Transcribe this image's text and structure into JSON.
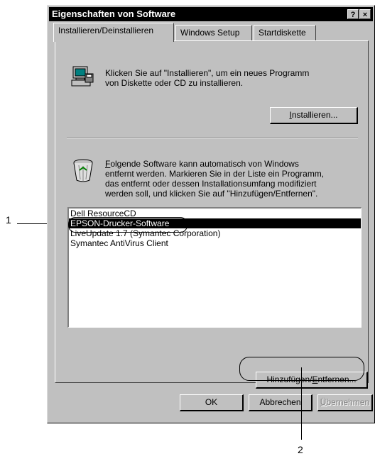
{
  "dialog": {
    "title": "Eigenschaften von Software",
    "help_button": "?",
    "close_button": "×"
  },
  "tabs": [
    {
      "label": "Installieren/Deinstallieren",
      "active": true
    },
    {
      "label": "Windows Setup",
      "active": false
    },
    {
      "label": "Startdiskette",
      "active": false
    }
  ],
  "install_section": {
    "icon": "computer-install-icon",
    "line1": "Klicken Sie auf \"Installieren\", um ein neues Programm",
    "line2": "von Diskette oder CD zu installieren.",
    "button_pre": "",
    "button_u": "I",
    "button_post": "nstallieren..."
  },
  "uninstall_section": {
    "icon": "recycle-bin-icon",
    "line1_u": "F",
    "line1_rest": "olgende Software kann automatisch von Windows",
    "line2": "entfernt werden. Markieren Sie in der Liste ein Programm,",
    "line3": "das entfernt oder dessen Installationsumfang modifiziert",
    "line4": "werden soll, und klicken Sie auf \"Hinzufügen/Entfernen\"."
  },
  "software_list": [
    {
      "label": "Dell ResourceCD",
      "selected": false
    },
    {
      "label": "EPSON-Drucker-Software",
      "selected": true
    },
    {
      "label": "LiveUpdate 1.7 (Symantec Corporation)",
      "selected": false
    },
    {
      "label": "Symantec AntiVirus Client",
      "selected": false
    }
  ],
  "add_remove_button": {
    "pre": "Hinzufügen/",
    "u": "E",
    "post": "ntfernen..."
  },
  "footer": {
    "ok": "OK",
    "cancel": "Abbrechen",
    "apply_u": "Ü",
    "apply_rest": "bernehmen"
  },
  "callouts": {
    "one": "1",
    "two": "2"
  }
}
